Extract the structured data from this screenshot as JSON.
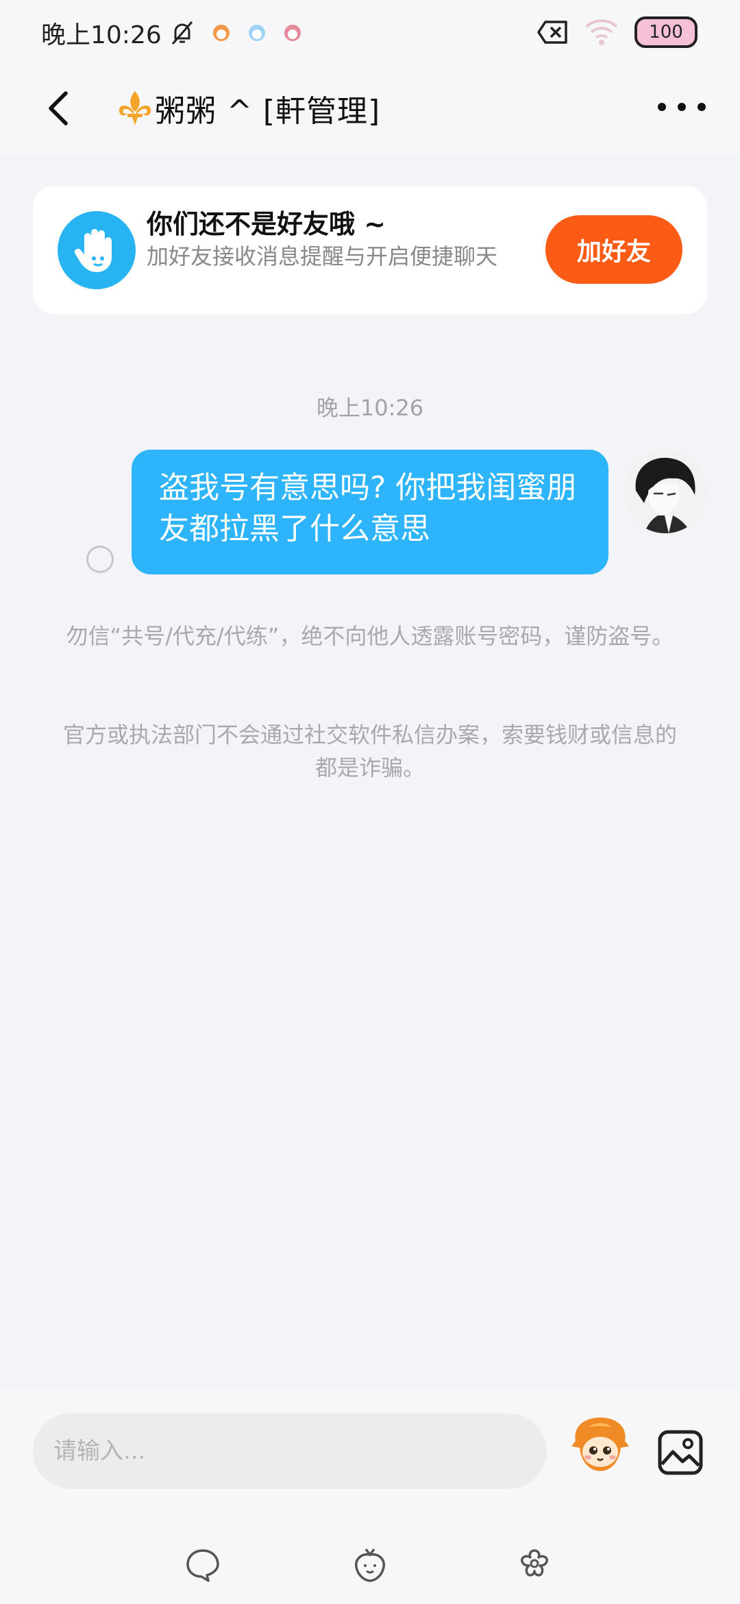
{
  "status_bar": {
    "time": "晚上10:26",
    "battery": "100"
  },
  "header": {
    "title": "粥粥 ^ [軒管理]"
  },
  "friend_banner": {
    "title": "你们还不是好友哦 ~",
    "subtitle": "加好友接收消息提醒与开启便捷聊天",
    "button_label": "加好友"
  },
  "conversation": {
    "timestamp": "晚上10:26",
    "messages": [
      {
        "sender": "self",
        "text": "盗我号有意思吗? 你把我闺蜜朋友都拉黑了什么意思"
      }
    ],
    "notices": [
      "勿信“共号/代充/代练”，绝不向他人透露账号密码，谨防盗号。",
      "官方或执法部门不会通过社交软件私信办案，索要钱财或信息的都是诈骗。"
    ]
  },
  "input_bar": {
    "placeholder": "请输入..."
  },
  "colors": {
    "accent_blue": "#2eb4fb",
    "add_friend_orange": "#fb5b14",
    "background": "#f3f4f8"
  }
}
